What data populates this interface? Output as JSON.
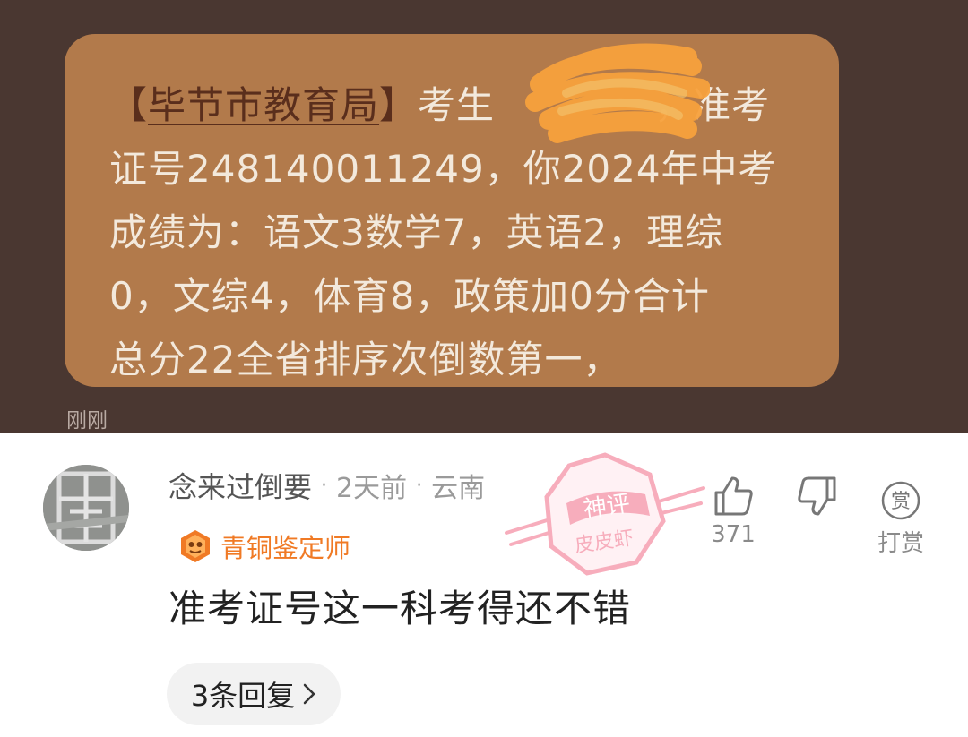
{
  "sms": {
    "sender_open": "【",
    "sender": "毕节市教育局",
    "sender_close": "】",
    "line1_rest": "考生",
    "line1_end": "，准考",
    "line2": "证号248140011249，你2024年中考",
    "line3": "成绩为：语文3数学7，英语2，理综",
    "line4": "0，文综4，体育8，政策加0分合计",
    "line5": "总分22全省排序次倒数第一，",
    "time": "刚刚"
  },
  "comment": {
    "username": "念来过倒要",
    "time_ago": "2天前",
    "location": "云南",
    "badge": "青铜鉴定师",
    "text": "准考证号这一科考得还不错",
    "reply_label": "3条回复",
    "like_count": "371",
    "reward_label": "打赏",
    "reward_icon_char": "赏",
    "stamp_top": "神评",
    "stamp_bottom": "皮皮虾"
  },
  "icons": {
    "like": "thumbs-up-icon",
    "dislike": "thumbs-down-icon",
    "reward": "reward-icon",
    "badge": "bronze-badge-icon",
    "reply_chevron": "chevron-right-icon"
  },
  "colors": {
    "badge_orange": "#f07a25",
    "stamp_pink": "#f26b86",
    "bubble": "#b27a4b",
    "background_dark": "#4a3731"
  }
}
